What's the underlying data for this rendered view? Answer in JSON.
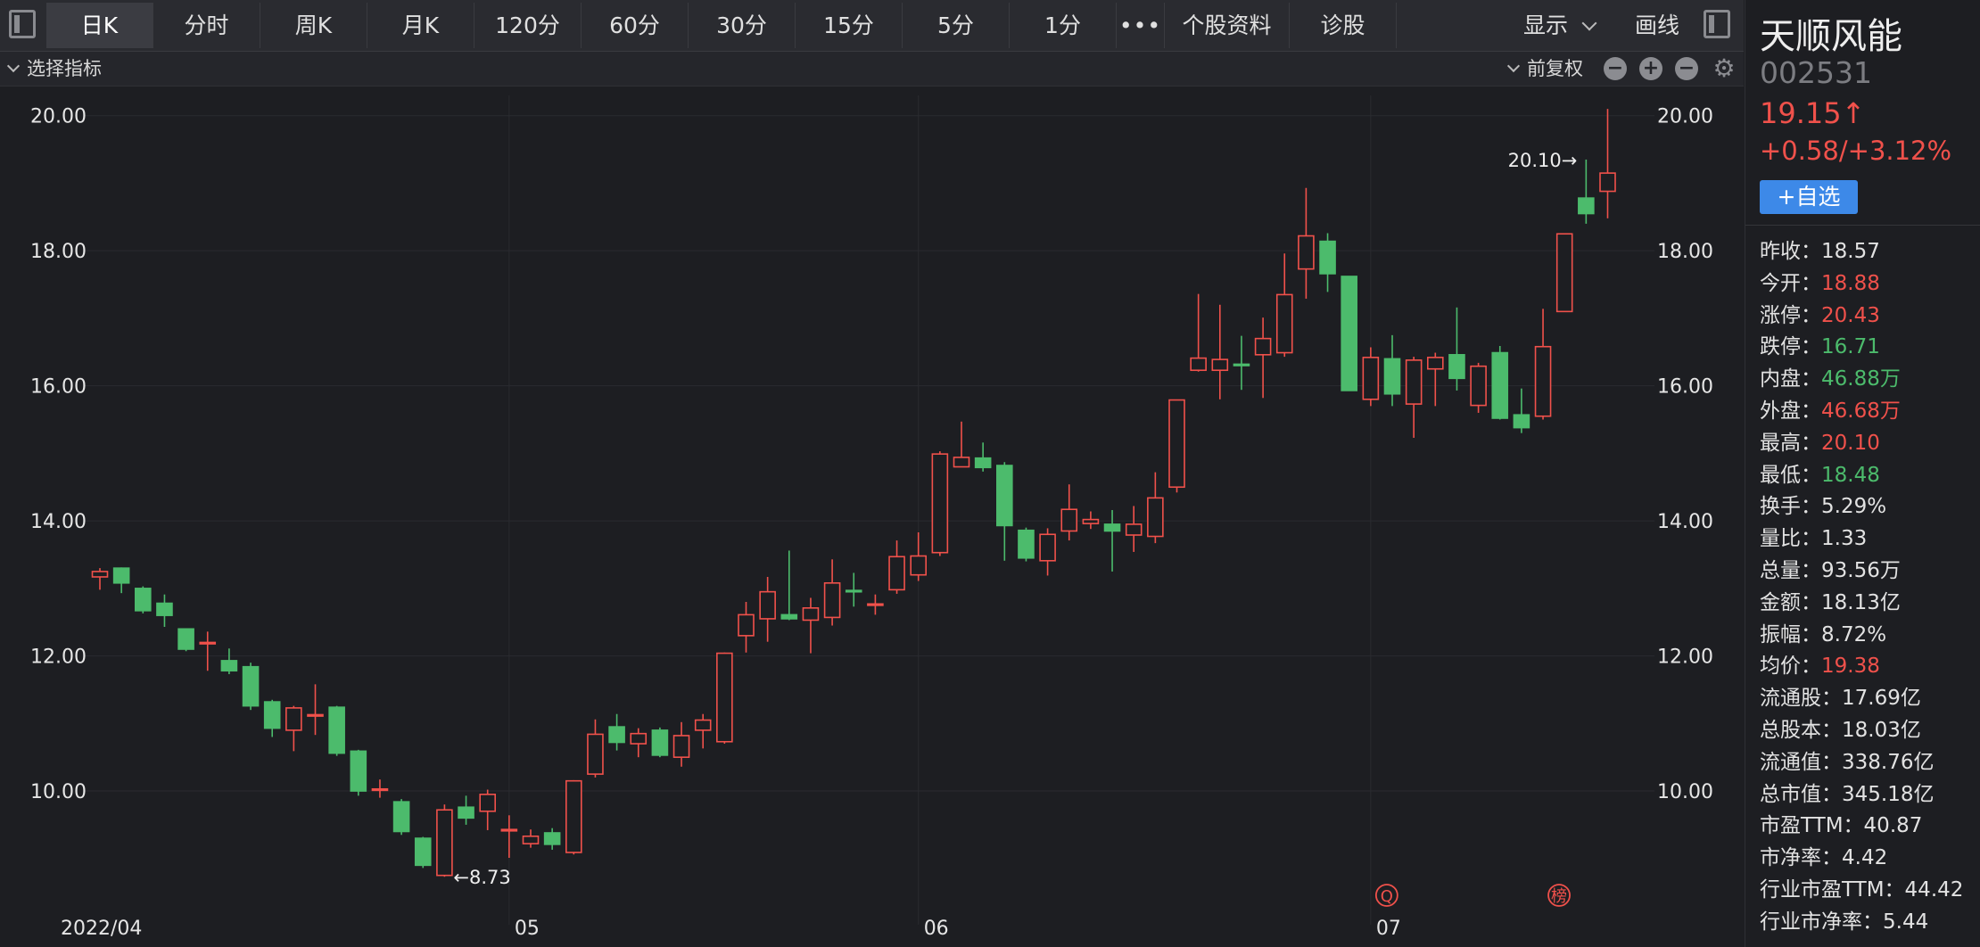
{
  "toolbar": {
    "tabs": [
      "日K",
      "分时",
      "周K",
      "月K",
      "120分",
      "60分",
      "30分",
      "15分",
      "5分",
      "1分",
      "•••",
      "个股资料",
      "诊股"
    ],
    "active_tab": "日K",
    "display_label": "显示",
    "draw_label": "画线"
  },
  "subbar": {
    "indicator_label": "选择指标",
    "adjust_label": "前复权"
  },
  "colors": {
    "up": "#f0514b",
    "down": "#4cbb6c",
    "accent": "#3d89e8",
    "background": "#1d1e22"
  },
  "chart_data": {
    "type": "candlestick",
    "y_ticks": [
      "20.00",
      "18.00",
      "16.00",
      "14.00",
      "12.00",
      "10.00"
    ],
    "ylim": [
      8.35,
      20.3
    ],
    "x_labels": [
      {
        "label": "2022/04",
        "index": 0
      },
      {
        "label": "05",
        "index": 19
      },
      {
        "label": "06",
        "index": 38
      },
      {
        "label": "07",
        "index": 59
      }
    ],
    "max_annotation": {
      "label": "20.10→",
      "index": 69
    },
    "min_annotation": {
      "label": "←8.73",
      "index": 16
    },
    "markers": [
      {
        "label": "Q",
        "index": 59
      },
      {
        "label": "榜",
        "index": 67
      }
    ],
    "candles": [
      [
        13.17,
        13.25,
        13.3,
        12.98
      ],
      [
        13.3,
        13.08,
        13.31,
        12.93
      ],
      [
        13.0,
        12.67,
        13.03,
        12.63
      ],
      [
        12.78,
        12.6,
        12.91,
        12.43
      ],
      [
        12.4,
        12.1,
        12.41,
        12.07
      ],
      [
        12.2,
        12.2,
        12.36,
        11.78
      ],
      [
        11.93,
        11.78,
        12.11,
        11.73
      ],
      [
        11.84,
        11.26,
        11.9,
        11.2
      ],
      [
        11.32,
        10.93,
        11.35,
        10.8
      ],
      [
        10.9,
        11.23,
        11.26,
        10.59
      ],
      [
        11.13,
        11.13,
        11.58,
        10.83
      ],
      [
        11.24,
        10.56,
        11.26,
        10.52
      ],
      [
        10.59,
        10.0,
        10.61,
        9.93
      ],
      [
        10.03,
        10.03,
        10.17,
        9.9
      ],
      [
        9.84,
        9.4,
        9.88,
        9.35
      ],
      [
        9.3,
        8.9,
        9.32,
        8.86
      ],
      [
        8.75,
        9.72,
        9.8,
        8.73
      ],
      [
        9.76,
        9.6,
        9.93,
        9.5
      ],
      [
        9.7,
        9.95,
        10.02,
        9.42
      ],
      [
        9.42,
        9.43,
        9.64,
        9.01
      ],
      [
        9.22,
        9.33,
        9.43,
        9.16
      ],
      [
        9.38,
        9.21,
        9.45,
        9.13
      ],
      [
        9.09,
        10.15,
        10.16,
        9.06
      ],
      [
        10.25,
        10.84,
        11.06,
        10.2
      ],
      [
        10.95,
        10.72,
        11.14,
        10.6
      ],
      [
        10.7,
        10.85,
        10.93,
        10.5
      ],
      [
        10.9,
        10.53,
        10.94,
        10.5
      ],
      [
        10.5,
        10.82,
        11.02,
        10.36
      ],
      [
        10.9,
        11.05,
        11.14,
        10.63
      ],
      [
        10.73,
        12.04,
        12.05,
        10.7
      ],
      [
        12.3,
        12.61,
        12.8,
        12.05
      ],
      [
        12.55,
        12.95,
        13.17,
        12.21
      ],
      [
        12.61,
        12.55,
        13.56,
        12.53
      ],
      [
        12.53,
        12.71,
        12.86,
        12.04
      ],
      [
        12.57,
        13.08,
        13.43,
        12.45
      ],
      [
        12.97,
        12.95,
        13.23,
        12.73
      ],
      [
        12.75,
        12.77,
        12.91,
        12.61
      ],
      [
        12.98,
        13.47,
        13.71,
        12.92
      ],
      [
        13.2,
        13.48,
        13.83,
        13.11
      ],
      [
        13.53,
        14.99,
        15.03,
        13.48
      ],
      [
        14.8,
        14.94,
        15.47,
        14.88
      ],
      [
        14.93,
        14.79,
        15.16,
        14.73
      ],
      [
        14.82,
        13.93,
        14.87,
        13.41
      ],
      [
        13.86,
        13.45,
        13.9,
        13.4
      ],
      [
        13.41,
        13.8,
        13.89,
        13.19
      ],
      [
        13.85,
        14.17,
        14.54,
        13.71
      ],
      [
        13.96,
        14.02,
        14.14,
        13.88
      ],
      [
        13.95,
        13.85,
        14.16,
        13.25
      ],
      [
        13.79,
        13.95,
        14.22,
        13.54
      ],
      [
        13.77,
        14.34,
        14.72,
        13.67
      ],
      [
        14.5,
        15.79,
        15.78,
        14.42
      ],
      [
        16.23,
        16.41,
        17.36,
        16.21
      ],
      [
        16.23,
        16.39,
        17.2,
        15.8
      ],
      [
        16.32,
        16.3,
        16.74,
        15.94
      ],
      [
        16.46,
        16.7,
        17.01,
        15.82
      ],
      [
        16.49,
        17.35,
        17.96,
        16.43
      ],
      [
        17.73,
        18.22,
        18.93,
        17.29
      ],
      [
        18.14,
        17.66,
        18.26,
        17.39
      ],
      [
        17.62,
        15.93,
        17.62,
        15.93
      ],
      [
        15.8,
        16.42,
        16.57,
        15.7
      ],
      [
        16.4,
        15.88,
        16.75,
        15.7
      ],
      [
        15.73,
        16.38,
        16.43,
        15.23
      ],
      [
        16.25,
        16.42,
        16.49,
        15.7
      ],
      [
        16.46,
        16.11,
        17.16,
        15.93
      ],
      [
        15.71,
        16.29,
        16.34,
        15.6
      ],
      [
        16.49,
        15.52,
        16.59,
        15.5
      ],
      [
        15.57,
        15.38,
        15.96,
        15.3
      ],
      [
        15.55,
        16.58,
        17.14,
        15.5
      ],
      [
        17.1,
        18.25,
        18.25,
        17.1
      ],
      [
        18.78,
        18.55,
        19.35,
        18.4
      ],
      [
        18.88,
        19.15,
        20.1,
        18.48
      ]
    ]
  },
  "sidebar": {
    "name": "天顺风能",
    "code": "002531",
    "price": "19.15↑",
    "change": "+0.58/+3.12%",
    "add_label": "+自选",
    "stats": [
      {
        "label": "昨收：",
        "value": "18.57",
        "color": "neutral"
      },
      {
        "label": "今开：",
        "value": "18.88",
        "color": "up"
      },
      {
        "label": "涨停：",
        "value": "20.43",
        "color": "up"
      },
      {
        "label": "跌停：",
        "value": "16.71",
        "color": "down"
      },
      {
        "label": "内盘：",
        "value": "46.88万",
        "color": "down"
      },
      {
        "label": "外盘：",
        "value": "46.68万",
        "color": "up"
      },
      {
        "label": "最高：",
        "value": "20.10",
        "color": "up"
      },
      {
        "label": "最低：",
        "value": "18.48",
        "color": "down"
      },
      {
        "label": "换手：",
        "value": "5.29%",
        "color": "neutral"
      },
      {
        "label": "量比：",
        "value": "1.33",
        "color": "neutral"
      },
      {
        "label": "总量：",
        "value": "93.56万",
        "color": "neutral"
      },
      {
        "label": "金额：",
        "value": "18.13亿",
        "color": "neutral"
      },
      {
        "label": "振幅：",
        "value": "8.72%",
        "color": "neutral"
      },
      {
        "label": "均价：",
        "value": "19.38",
        "color": "up"
      },
      {
        "label": "流通股：",
        "value": "17.69亿",
        "color": "neutral"
      },
      {
        "label": "总股本：",
        "value": "18.03亿",
        "color": "neutral"
      },
      {
        "label": "流通值：",
        "value": "338.76亿",
        "color": "neutral"
      },
      {
        "label": "总市值：",
        "value": "345.18亿",
        "color": "neutral"
      },
      {
        "label": "市盈TTM：",
        "value": "40.87",
        "color": "neutral"
      },
      {
        "label": "市净率：",
        "value": "4.42",
        "color": "neutral"
      },
      {
        "label": "行业市盈TTM：",
        "value": "44.42",
        "color": "neutral"
      },
      {
        "label": "行业市净率：",
        "value": "5.44",
        "color": "neutral"
      }
    ]
  }
}
